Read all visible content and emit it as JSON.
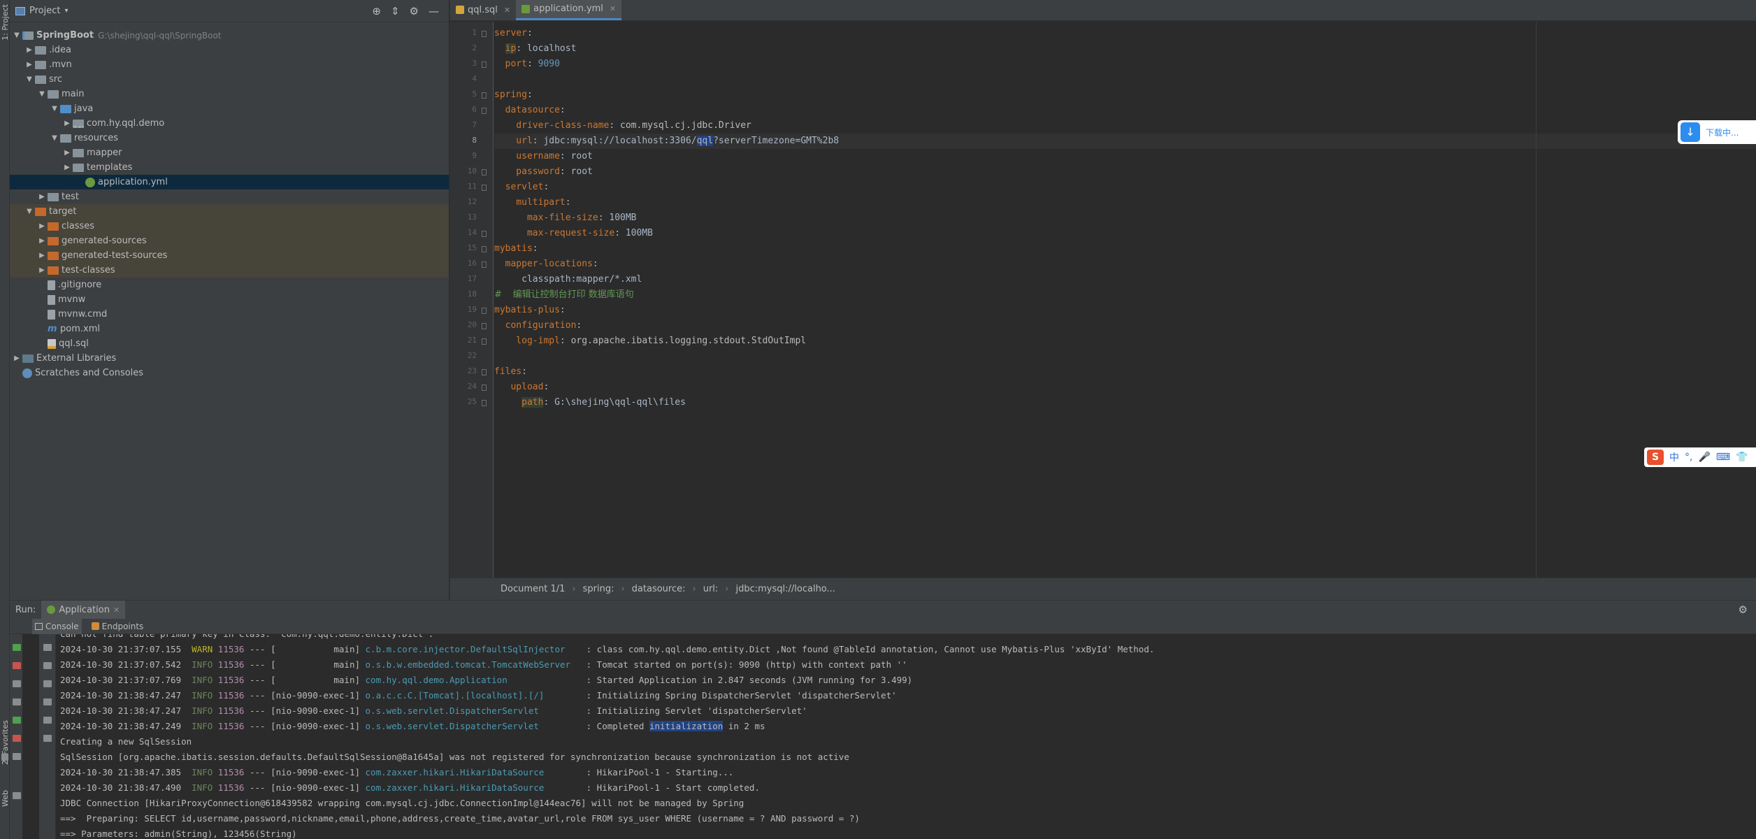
{
  "side_strip": {
    "project_label": "1: Project",
    "favorites_label": "2: Favorites",
    "web_label": "Web"
  },
  "project_panel": {
    "title": "Project",
    "tree": [
      {
        "label": "SpringBoot",
        "path": "G:\\shejing\\qql-qql\\SpringBoot",
        "depth": 0,
        "arrow": "open",
        "icon": "module",
        "bold": true
      },
      {
        "label": ".idea",
        "depth": 1,
        "arrow": "closed",
        "icon": "folder"
      },
      {
        "label": ".mvn",
        "depth": 1,
        "arrow": "closed",
        "icon": "folder"
      },
      {
        "label": "src",
        "depth": 1,
        "arrow": "open",
        "icon": "folder"
      },
      {
        "label": "main",
        "depth": 2,
        "arrow": "open",
        "icon": "folder"
      },
      {
        "label": "java",
        "depth": 3,
        "arrow": "open",
        "icon": "folder-blue"
      },
      {
        "label": "com.hy.qql.demo",
        "depth": 4,
        "arrow": "closed",
        "icon": "pkg"
      },
      {
        "label": "resources",
        "depth": 3,
        "arrow": "open",
        "icon": "folder"
      },
      {
        "label": "mapper",
        "depth": 4,
        "arrow": "closed",
        "icon": "folder"
      },
      {
        "label": "templates",
        "depth": 4,
        "arrow": "closed",
        "icon": "folder"
      },
      {
        "label": "application.yml",
        "depth": 5,
        "arrow": "none",
        "icon": "yml",
        "selected": true
      },
      {
        "label": "test",
        "depth": 2,
        "arrow": "closed",
        "icon": "folder"
      },
      {
        "label": "target",
        "depth": 1,
        "arrow": "open",
        "icon": "folder-orange",
        "excluded": true
      },
      {
        "label": "classes",
        "depth": 2,
        "arrow": "closed",
        "icon": "folder-orange",
        "excluded": true
      },
      {
        "label": "generated-sources",
        "depth": 2,
        "arrow": "closed",
        "icon": "folder-orange",
        "excluded": true
      },
      {
        "label": "generated-test-sources",
        "depth": 2,
        "arrow": "closed",
        "icon": "folder-orange",
        "excluded": true
      },
      {
        "label": "test-classes",
        "depth": 2,
        "arrow": "closed",
        "icon": "folder-orange",
        "excluded": true
      },
      {
        "label": ".gitignore",
        "depth": 2,
        "arrow": "none",
        "icon": "file"
      },
      {
        "label": "mvnw",
        "depth": 2,
        "arrow": "none",
        "icon": "file"
      },
      {
        "label": "mvnw.cmd",
        "depth": 2,
        "arrow": "none",
        "icon": "file"
      },
      {
        "label": "pom.xml",
        "depth": 2,
        "arrow": "none",
        "icon": "m"
      },
      {
        "label": "qql.sql",
        "depth": 2,
        "arrow": "none",
        "icon": "sql"
      },
      {
        "label": "External Libraries",
        "depth": 0,
        "arrow": "closed",
        "icon": "lib"
      },
      {
        "label": "Scratches and Consoles",
        "depth": 0,
        "arrow": "none",
        "icon": "scr"
      }
    ]
  },
  "editor": {
    "tabs": [
      {
        "label": "qql.sql",
        "active": false,
        "icon": "sql"
      },
      {
        "label": "application.yml",
        "active": true,
        "icon": "yml"
      }
    ],
    "current_line": 8,
    "lines": [
      [
        {
          "t": "server",
          "c": "k"
        },
        {
          "t": ":",
          "c": "v"
        }
      ],
      [
        {
          "t": "  ",
          "c": "v"
        },
        {
          "t": "ip",
          "c": "k hl"
        },
        {
          "t": ": localhost",
          "c": "v"
        }
      ],
      [
        {
          "t": "  port",
          "c": "k"
        },
        {
          "t": ": ",
          "c": "v"
        },
        {
          "t": "9090",
          "c": "n"
        }
      ],
      [],
      [
        {
          "t": "spring",
          "c": "k"
        },
        {
          "t": ":",
          "c": "v"
        }
      ],
      [
        {
          "t": "  datasource",
          "c": "k"
        },
        {
          "t": ":",
          "c": "v"
        }
      ],
      [
        {
          "t": "    driver-class-name",
          "c": "k"
        },
        {
          "t": ": ",
          "c": "v"
        },
        {
          "t": "com.mysql.cj.jdbc.Driver",
          "c": "logger"
        }
      ],
      [
        {
          "t": "    url",
          "c": "k"
        },
        {
          "t": ": jdbc:mysql://localhost:3306/",
          "c": "v"
        },
        {
          "t": "qql",
          "c": "v sel"
        },
        {
          "t": "?serverTimezone=GMT%2b8",
          "c": "v"
        }
      ],
      [
        {
          "t": "    username",
          "c": "k"
        },
        {
          "t": ": root",
          "c": "v"
        }
      ],
      [
        {
          "t": "    password",
          "c": "k"
        },
        {
          "t": ": root",
          "c": "v"
        }
      ],
      [
        {
          "t": "  servlet",
          "c": "k"
        },
        {
          "t": ":",
          "c": "v"
        }
      ],
      [
        {
          "t": "    multipart",
          "c": "k"
        },
        {
          "t": ":",
          "c": "v"
        }
      ],
      [
        {
          "t": "      max-file-size",
          "c": "k"
        },
        {
          "t": ": 100MB",
          "c": "v"
        }
      ],
      [
        {
          "t": "      max-request-size",
          "c": "k"
        },
        {
          "t": ": 100MB",
          "c": "v"
        }
      ],
      [
        {
          "t": "mybatis",
          "c": "k"
        },
        {
          "t": ":",
          "c": "v"
        }
      ],
      [
        {
          "t": "  mapper-locations",
          "c": "k"
        },
        {
          "t": ":",
          "c": "v"
        }
      ],
      [
        {
          "t": "     classpath:mapper/*.xml",
          "c": "v"
        }
      ],
      [
        {
          "t": "#",
          "c": "cm"
        },
        {
          "t": "  ",
          "c": "v"
        },
        {
          "t": "编辑让控制台打印 数据库语句",
          "c": "cm"
        }
      ],
      [
        {
          "t": "mybatis-plus",
          "c": "k"
        },
        {
          "t": ":",
          "c": "v"
        }
      ],
      [
        {
          "t": "  configuration",
          "c": "k"
        },
        {
          "t": ":",
          "c": "v"
        }
      ],
      [
        {
          "t": "    log-impl",
          "c": "k"
        },
        {
          "t": ": ",
          "c": "v"
        },
        {
          "t": "org.apache.ibatis.logging.stdout.StdOutImpl",
          "c": "logger"
        }
      ],
      [],
      [
        {
          "t": "files",
          "c": "k"
        },
        {
          "t": ":",
          "c": "v"
        }
      ],
      [
        {
          "t": "   upload",
          "c": "k"
        },
        {
          "t": ":",
          "c": "v"
        }
      ],
      [
        {
          "t": "     ",
          "c": "v"
        },
        {
          "t": "path",
          "c": "k hl"
        },
        {
          "t": ": G:\\shejing\\qql-qql\\files",
          "c": "v"
        }
      ]
    ],
    "breadcrumb": [
      "Document 1/1",
      "spring:",
      "datasource:",
      "url:",
      "jdbc:mysql://localho..."
    ]
  },
  "download_widget": {
    "label": "下载中..."
  },
  "ime_bar": {
    "logo": "S",
    "items": [
      "中",
      "°,",
      "🎤",
      "⌨",
      "👕"
    ]
  },
  "run_panel": {
    "run_label": "Run:",
    "config_name": "Application",
    "subtabs": [
      "Console",
      "Endpoints"
    ],
    "logs": [
      {
        "plain": "Can not find table primary key in Class: \"com.hy.qql.demo.entity.Dict\"."
      },
      {
        "ts": "2024-10-30 21:37:07.155",
        "level": "WARN",
        "pid": "11536",
        "thread": " --- [           main] ",
        "logger": "c.b.m.core.injector.DefaultSqlInjector   ",
        "msg": " : class com.hy.qql.demo.entity.Dict ,Not found @TableId annotation, Cannot use Mybatis-Plus 'xxById' Method."
      },
      {
        "ts": "2024-10-30 21:37:07.542",
        "level": "INFO",
        "pid": "11536",
        "thread": " --- [           main] ",
        "logger": "o.s.b.w.embedded.tomcat.TomcatWebServer  ",
        "msg": " : Tomcat started on port(s): 9090 (http) with context path ''"
      },
      {
        "ts": "2024-10-30 21:37:07.769",
        "level": "INFO",
        "pid": "11536",
        "thread": " --- [           main] ",
        "logger": "com.hy.qql.demo.Application              ",
        "msg": " : Started Application in 2.847 seconds (JVM running for 3.499)"
      },
      {
        "ts": "2024-10-30 21:38:47.247",
        "level": "INFO",
        "pid": "11536",
        "thread": " --- [nio-9090-exec-1] ",
        "logger": "o.a.c.c.C.[Tomcat].[localhost].[/]       ",
        "msg": " : Initializing Spring DispatcherServlet 'dispatcherServlet'"
      },
      {
        "ts": "2024-10-30 21:38:47.247",
        "level": "INFO",
        "pid": "11536",
        "thread": " --- [nio-9090-exec-1] ",
        "logger": "o.s.web.servlet.DispatcherServlet        ",
        "msg": " : Initializing Servlet 'dispatcherServlet'"
      },
      {
        "ts": "2024-10-30 21:38:47.249",
        "level": "INFO",
        "pid": "11536",
        "thread": " --- [nio-9090-exec-1] ",
        "logger": "o.s.web.servlet.DispatcherServlet        ",
        "msg": " : Completed ",
        "hl": "initialization",
        "msg2": " in 2 ms"
      },
      {
        "plain": "Creating a new SqlSession"
      },
      {
        "plain": "SqlSession [org.apache.ibatis.session.defaults.DefaultSqlSession@8a1645a] was not registered for synchronization because synchronization is not active"
      },
      {
        "ts": "2024-10-30 21:38:47.385",
        "level": "INFO",
        "pid": "11536",
        "thread": " --- [nio-9090-exec-1] ",
        "logger": "com.zaxxer.hikari.HikariDataSource       ",
        "msg": " : HikariPool-1 - Starting..."
      },
      {
        "ts": "2024-10-30 21:38:47.490",
        "level": "INFO",
        "pid": "11536",
        "thread": " --- [nio-9090-exec-1] ",
        "logger": "com.zaxxer.hikari.HikariDataSource       ",
        "msg": " : HikariPool-1 - Start completed."
      },
      {
        "plain": "JDBC Connection [HikariProxyConnection@618439582 wrapping com.mysql.cj.jdbc.ConnectionImpl@144eac76] will not be managed by Spring"
      },
      {
        "plain": "==>  Preparing: SELECT id,username,password,nickname,email,phone,address,create_time,avatar_url,role FROM sys_user WHERE (username = ? AND password = ?)"
      },
      {
        "plain": "==> Parameters: admin(String), 123456(String)"
      }
    ]
  }
}
